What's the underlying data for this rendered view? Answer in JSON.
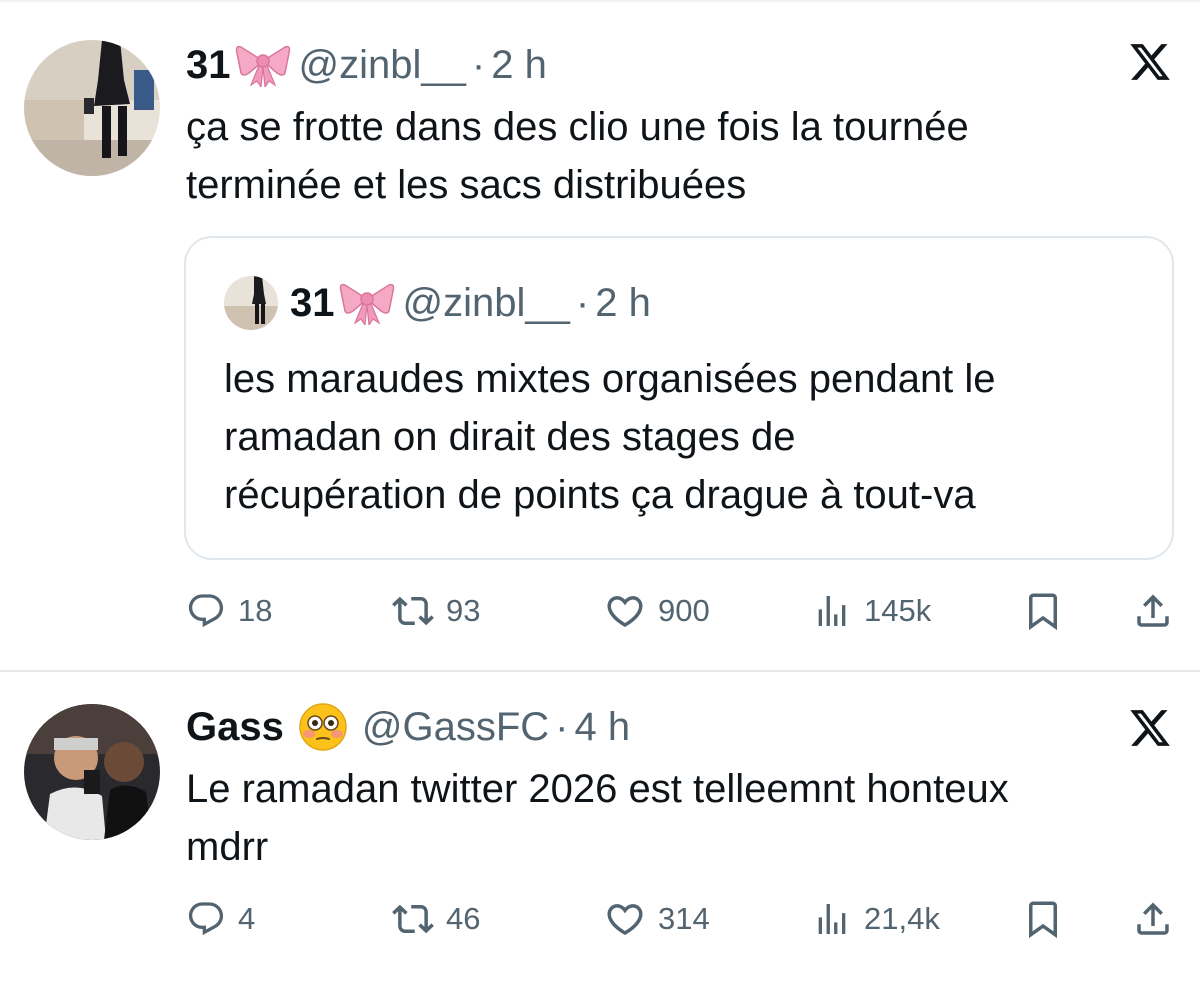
{
  "tweets": [
    {
      "display_name": "31",
      "name_emoji": "ribbon-emoji",
      "handle": "@zinbl__",
      "separator": "·",
      "time": "2 h",
      "text_lines": [
        "ça se frotte dans des clio une fois la tournée",
        "terminée et les sacs distribuées"
      ],
      "quote": {
        "display_name": "31",
        "name_emoji": "ribbon-emoji",
        "handle": "@zinbl__",
        "separator": "·",
        "time": "2 h",
        "text_lines": [
          "les maraudes mixtes organisées pendant le",
          "ramadan on dirait des stages de",
          "récupération de points ça drague à tout-va"
        ]
      },
      "stats": {
        "replies": "18",
        "reposts": "93",
        "likes": "900",
        "views": "145k"
      }
    },
    {
      "display_name": "Gass",
      "name_emoji": "flushed-face-emoji",
      "handle": "@GassFC",
      "separator": "·",
      "time": "4 h",
      "text_lines": [
        "Le ramadan twitter 2026 est telleemnt honteux",
        "mdrr"
      ],
      "stats": {
        "replies": "4",
        "reposts": "46",
        "likes": "314",
        "views": "21,4k"
      }
    }
  ],
  "icons": {
    "brand": "x-logo-icon",
    "reply": "reply-icon",
    "repost": "repost-icon",
    "like": "heart-icon",
    "views": "views-icon",
    "bookmark": "bookmark-icon",
    "share": "share-icon"
  },
  "colors": {
    "text": "#0f1419",
    "secondary": "#536471",
    "border": "#e1e8ed"
  }
}
